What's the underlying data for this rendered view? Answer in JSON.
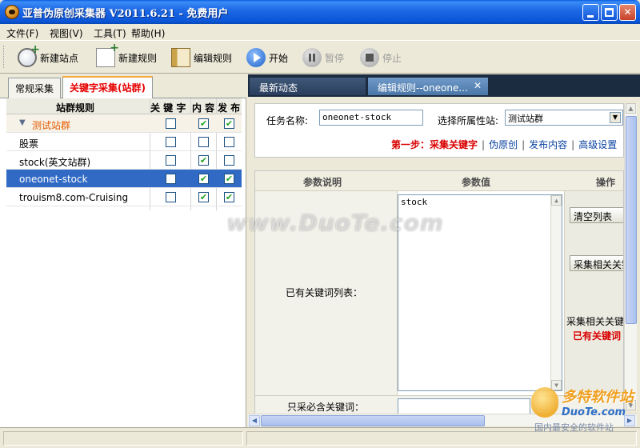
{
  "window": {
    "title": "亚普伪原创采集器 V2011.6.21 - 免费用户"
  },
  "menu": [
    {
      "label": "文件(F)"
    },
    {
      "label": "视图(V)"
    },
    {
      "label": "工具(T)"
    },
    {
      "label": "帮助(H)"
    }
  ],
  "toolbar": {
    "new_site": "新建站点",
    "new_rule": "新建规则",
    "edit_rule": "编辑规则",
    "start": "开始",
    "pause": "暂停",
    "stop": "停止"
  },
  "left_tabs": {
    "normal": "常规采集",
    "keyword": "关键字采集(站群)"
  },
  "grid": {
    "headers": {
      "name": "站群规则",
      "key": "关 键 字",
      "content": "内 容",
      "publish": "发 布"
    },
    "rows": [
      {
        "name": "测试站群",
        "type": "group",
        "key": false,
        "content": true,
        "publish": true
      },
      {
        "name": "股票",
        "key": false,
        "content": false,
        "publish": false
      },
      {
        "name": "stock(英文站群)",
        "key": false,
        "content": true,
        "publish": false
      },
      {
        "name": "oneonet-stock",
        "selected": true,
        "key": false,
        "content": true,
        "publish": true
      },
      {
        "name": "trouism8.com-Cruising",
        "key": false,
        "content": true,
        "publish": true
      }
    ]
  },
  "right_tabs": {
    "latest": "最新动态",
    "edit": "编辑规则--oneone..."
  },
  "form": {
    "task_label": "任务名称:",
    "task_value": "oneonet-stock",
    "site_label": "选择所属性站:",
    "site_value": "测试站群"
  },
  "steps": {
    "step1": "第一步：采集关键字",
    "step2": "伪原创",
    "step3": "发布内容",
    "step4": "高级设置"
  },
  "params": {
    "col_desc": "参数说明",
    "col_value": "参数值",
    "col_op": "操作",
    "existing_label": "已有关键词列表：",
    "keywords": "stock",
    "clear_btn": "清空列表",
    "collect_btn": "采集相关关键",
    "note1": "采集相关关键",
    "note2": "已有关键词",
    "only_label": "只采必含关键词："
  },
  "watermark": {
    "center": "www.DuoTe.com",
    "logo_title": "多特软件站",
    "logo_sub": "DuoTe.com",
    "logo_tag": "国内最安全的软件站"
  },
  "colors": {
    "accent": "#316ac5",
    "red": "#d90000",
    "check": "#21a121"
  }
}
